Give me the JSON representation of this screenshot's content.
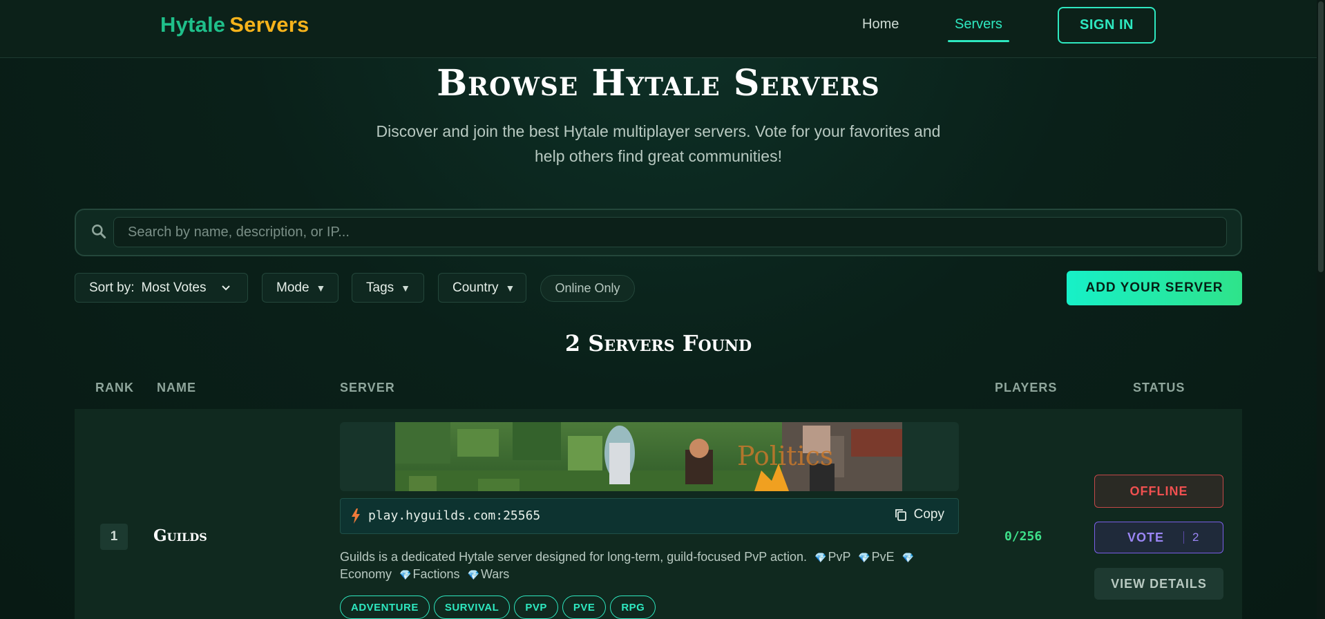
{
  "nav": {
    "brand_part1": "Hytale",
    "brand_part2": "Servers",
    "home": "Home",
    "servers": "Servers",
    "sign_in": "SIGN IN"
  },
  "hero": {
    "title": "Browse Hytale Servers",
    "subtitle": "Discover and join the best Hytale multiplayer servers. Vote for your favorites and help others find great communities!"
  },
  "search": {
    "placeholder": "Search by name, description, or IP...",
    "value": ""
  },
  "filters": {
    "sort_label": "Sort by:",
    "sort_value": "Most Votes",
    "mode": "Mode",
    "tags": "Tags",
    "country": "Country",
    "online_only": "Online Only",
    "add_server": "ADD YOUR SERVER"
  },
  "results": {
    "title": "2 Servers Found"
  },
  "table": {
    "headers": {
      "rank": "RANK",
      "name": "NAME",
      "server": "SERVER",
      "players": "PLAYERS",
      "status": "STATUS"
    },
    "rows": [
      {
        "rank": "1",
        "name": "Guilds",
        "banner_text": "Politics",
        "ip": "play.hyguilds.com:25565",
        "copy_label": "Copy",
        "description_main": "Guilds is a dedicated Hytale server designed for long-term, guild-focused PvP action.",
        "features": [
          "PvP",
          "PvE",
          "Economy",
          "Factions",
          "Wars"
        ],
        "tags": [
          "ADVENTURE",
          "SURVIVAL",
          "PVP",
          "PVE",
          "RPG"
        ],
        "players": "0/256",
        "status": "OFFLINE",
        "vote_label": "VOTE",
        "vote_count": "2",
        "details_label": "VIEW DETAILS"
      }
    ]
  },
  "colors": {
    "accent": "#2ee8c0",
    "brand_green": "#1fbf8a",
    "brand_gold": "#f5b21b",
    "offline_red": "#f05050",
    "vote_purple": "#9b86f5",
    "players_green": "#3ee08a"
  }
}
